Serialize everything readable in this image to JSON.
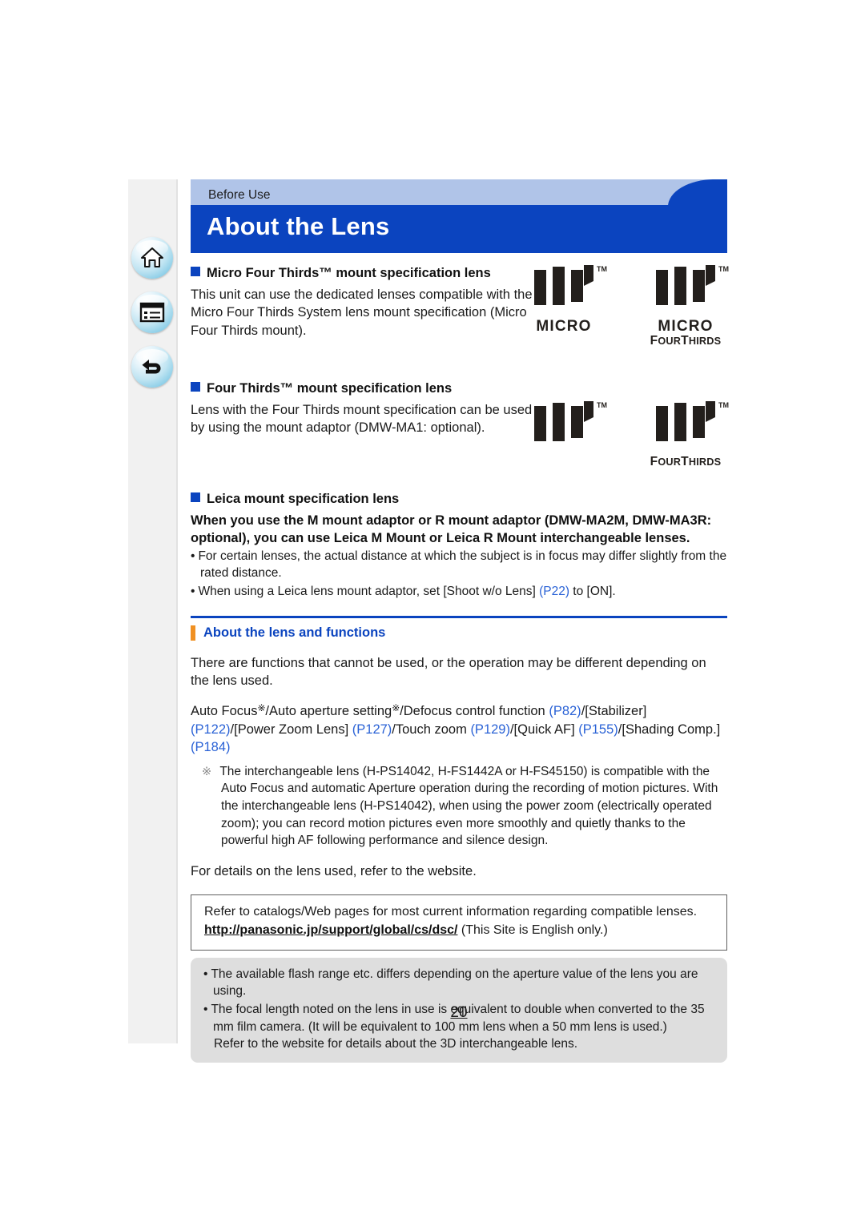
{
  "nav": {
    "home_label": "home-icon",
    "contents_label": "contents-icon",
    "back_label": "back-icon"
  },
  "header": {
    "breadcrumb": "Before Use",
    "title": "About the Lens"
  },
  "colors": {
    "title_bar": "#0b44bf",
    "breadcrumb_bar": "#b0c4e8",
    "accent_orange": "#f09022",
    "reference_link": "#2a62d6",
    "note_box": "#dedede"
  },
  "sections": {
    "micro_four_thirds": {
      "heading": "Micro Four Thirds™ mount specification lens",
      "body": "This unit can use the dedicated lenses compatible with the Micro Four Thirds System lens mount specification (Micro Four Thirds mount).",
      "logos": [
        {
          "mark": "four-thirds-mark",
          "tm": "TM",
          "word": "MICRO",
          "word2": ""
        },
        {
          "mark": "four-thirds-mark",
          "tm": "TM",
          "word": "MICRO",
          "word2": "FourThirds"
        }
      ]
    },
    "four_thirds": {
      "heading": "Four Thirds™ mount specification lens",
      "body": "Lens with the Four Thirds mount specification can be used by using the mount adaptor (DMW-MA1: optional).",
      "logos": [
        {
          "mark": "four-thirds-mark",
          "tm": "TM",
          "word": "",
          "word2": ""
        },
        {
          "mark": "four-thirds-mark",
          "tm": "TM",
          "word": "",
          "word2": "FourThirds"
        }
      ]
    },
    "leica": {
      "heading": "Leica mount specification lens",
      "bold_text": "When you use the M mount adaptor or R mount adaptor (DMW-MA2M, DMW-MA3R: optional), you can use Leica M Mount or Leica R Mount interchangeable lenses.",
      "bullets": [
        "For certain lenses, the actual distance at which the subject is in focus may differ slightly from the rated distance.",
        "When using a Leica lens mount adaptor, set [Shoot w/o Lens] (P22) to [ON]."
      ],
      "bullet2_prefix": "When using a Leica lens mount adaptor, set [Shoot w/o Lens] ",
      "bullet2_ref": "(P22)",
      "bullet2_suffix": " to [ON]."
    },
    "functions": {
      "heading": "About the lens and functions",
      "para1": "There are functions that cannot be used, or the operation may be different depending on the lens used.",
      "feature_list": {
        "seg1": "Auto Focus",
        "star1": "※",
        "seg2": "/Auto aperture setting",
        "star2": "※",
        "seg3": "/Defocus control function ",
        "ref_p82": "(P82)",
        "seg4": "/[Stabilizer] ",
        "ref_p122": "(P122)",
        "seg5": "/[Power Zoom Lens] ",
        "ref_p127": "(P127)",
        "seg6": "/Touch zoom ",
        "ref_p129": "(P129)",
        "seg7": "/[Quick AF] ",
        "ref_p155": "(P155)",
        "seg8": "/[Shading Comp.] ",
        "ref_p184": "(P184)"
      },
      "footnote_marker": "※",
      "footnote": "The interchangeable lens (H-PS14042, H-FS1442A or H-FS45150) is compatible with the Auto Focus and automatic Aperture operation during the recording of motion pictures. With the interchangeable lens (H-PS14042), when using the power zoom (electrically operated zoom); you can record motion pictures even more smoothly and quietly thanks to the powerful high AF following performance and silence design.",
      "para3": "For details on the lens used, refer to the website."
    },
    "url_box": {
      "line1": "Refer to catalogs/Web pages for most current information regarding compatible lenses.",
      "url": "http://panasonic.jp/support/global/cs/dsc/",
      "url_suffix": " (This Site is English only.)"
    },
    "note_box": {
      "bullet1": "The available flash range etc. differs depending on the aperture value of the lens you are using.",
      "bullet2": "The focal length noted on the lens in use is equivalent to double when converted to the 35 mm film camera. (It will be equivalent to 100 mm lens when a 50 mm lens is used.)",
      "continuation": "Refer to the website for details about the 3D interchangeable lens."
    }
  },
  "footer": {
    "page_number": "20"
  }
}
